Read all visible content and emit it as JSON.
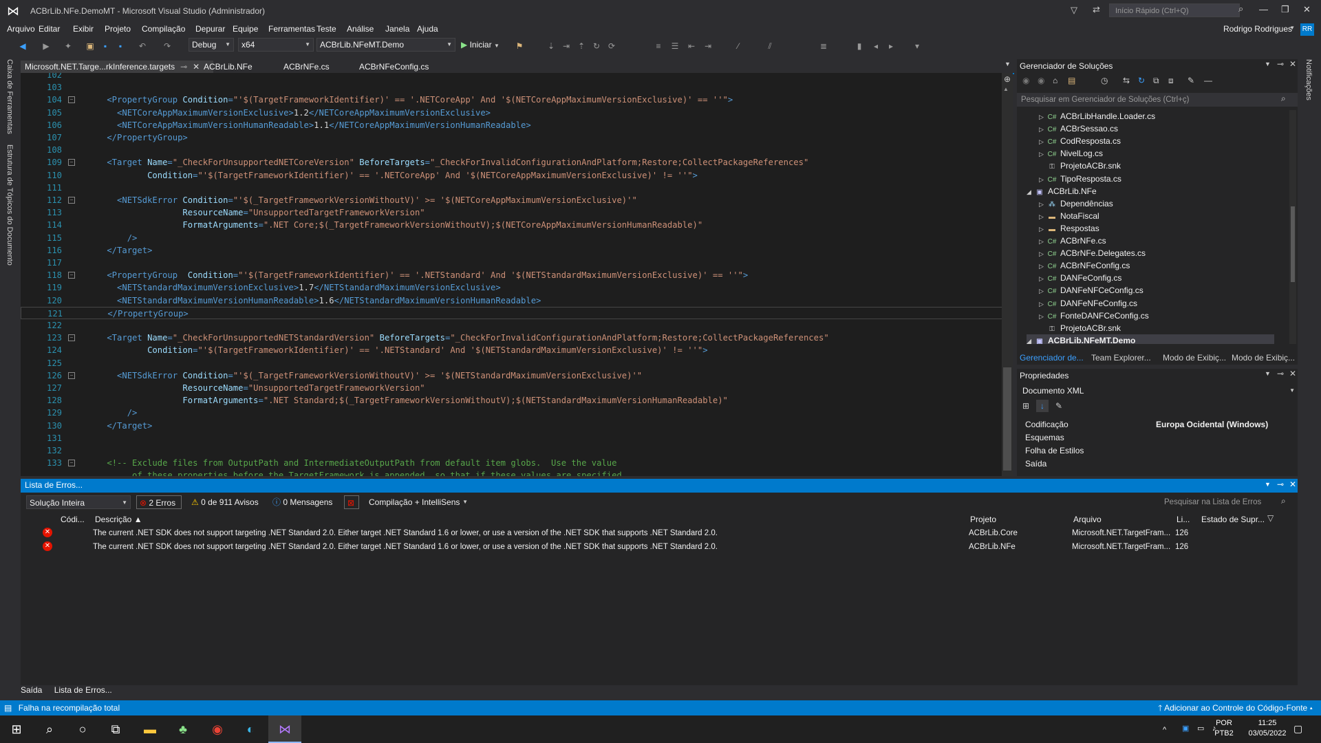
{
  "window": {
    "title": "ACBrLib.NFe.DemoMT - Microsoft Visual Studio (Administrador)",
    "quick_launch_placeholder": "Início Rápido (Ctrl+Q)"
  },
  "menu": [
    "Arquivo",
    "Editar",
    "Exibir",
    "Projeto",
    "Compilação",
    "Depurar",
    "Equipe",
    "Ferramentas",
    "Teste",
    "Análise",
    "Janela",
    "Ajuda"
  ],
  "user": {
    "name": "Rodrigo Rodrigues",
    "initials": "RR"
  },
  "toolbar": {
    "config": "Debug",
    "platform": "x64",
    "startup_project": "ACBrLib.NFeMT.Demo",
    "start_label": "Iniciar"
  },
  "side_tools": {
    "toolbox": "Caixa de Ferramentas",
    "document_outline": "Estrutura de Tópicos do Documento",
    "notifications": "Notificações"
  },
  "editor_tabs": [
    {
      "label": "Microsoft.NET.Targe...rkInference.targets",
      "active": true
    },
    {
      "label": "ACBrLib.NFe"
    },
    {
      "label": "ACBrNFe.cs"
    },
    {
      "label": "ACBrNFeConfig.cs"
    }
  ],
  "code_lines": [
    {
      "n": "102",
      "parts": []
    },
    {
      "n": "103",
      "parts": []
    },
    {
      "n": "104",
      "fold": true,
      "parts": [
        [
          "t",
          "    <PropertyGroup "
        ],
        [
          "a",
          "Condition"
        ],
        [
          "t",
          "="
        ],
        [
          "s",
          "\"'$(TargetFrameworkIdentifier)' == '.NETCoreApp' And '$(NETCoreAppMaximumVersionExclusive)' == ''\""
        ],
        [
          "t",
          ">"
        ]
      ]
    },
    {
      "n": "105",
      "parts": [
        [
          "t",
          "      <NETCoreAppMaximumVersionExclusive>"
        ],
        [
          "x",
          "1.2"
        ],
        [
          "t",
          "</NETCoreAppMaximumVersionExclusive>"
        ]
      ]
    },
    {
      "n": "106",
      "parts": [
        [
          "t",
          "      <NETCoreAppMaximumVersionHumanReadable>"
        ],
        [
          "x",
          "1.1"
        ],
        [
          "t",
          "</NETCoreAppMaximumVersionHumanReadable>"
        ]
      ]
    },
    {
      "n": "107",
      "parts": [
        [
          "t",
          "    </PropertyGroup>"
        ]
      ]
    },
    {
      "n": "108",
      "parts": []
    },
    {
      "n": "109",
      "fold": true,
      "parts": [
        [
          "t",
          "    <Target "
        ],
        [
          "a",
          "Name"
        ],
        [
          "t",
          "="
        ],
        [
          "s",
          "\"_CheckForUnsupportedNETCoreVersion\""
        ],
        [
          "t",
          " "
        ],
        [
          "a",
          "BeforeTargets"
        ],
        [
          "t",
          "="
        ],
        [
          "s",
          "\"_CheckForInvalidConfigurationAndPlatform;Restore;CollectPackageReferences\""
        ]
      ]
    },
    {
      "n": "110",
      "parts": [
        [
          "t",
          "            "
        ],
        [
          "a",
          "Condition"
        ],
        [
          "t",
          "="
        ],
        [
          "s",
          "\"'$(TargetFrameworkIdentifier)' == '.NETCoreApp' And '$(NETCoreAppMaximumVersionExclusive)' != ''\""
        ],
        [
          "t",
          ">"
        ]
      ]
    },
    {
      "n": "111",
      "parts": []
    },
    {
      "n": "112",
      "fold": true,
      "parts": [
        [
          "t",
          "      <NETSdkError "
        ],
        [
          "a",
          "Condition"
        ],
        [
          "t",
          "="
        ],
        [
          "s",
          "\"'$(_TargetFrameworkVersionWithoutV)' >= '$(NETCoreAppMaximumVersionExclusive)'\""
        ]
      ]
    },
    {
      "n": "113",
      "parts": [
        [
          "t",
          "                   "
        ],
        [
          "a",
          "ResourceName"
        ],
        [
          "t",
          "="
        ],
        [
          "s",
          "\"UnsupportedTargetFrameworkVersion\""
        ]
      ]
    },
    {
      "n": "114",
      "parts": [
        [
          "t",
          "                   "
        ],
        [
          "a",
          "FormatArguments"
        ],
        [
          "t",
          "="
        ],
        [
          "s",
          "\".NET Core;$(_TargetFrameworkVersionWithoutV);$(NETCoreAppMaximumVersionHumanReadable)\""
        ]
      ]
    },
    {
      "n": "115",
      "parts": [
        [
          "t",
          "        />"
        ]
      ]
    },
    {
      "n": "116",
      "parts": [
        [
          "t",
          "    </Target>"
        ]
      ]
    },
    {
      "n": "117",
      "parts": []
    },
    {
      "n": "118",
      "fold": true,
      "parts": [
        [
          "t",
          "    <PropertyGroup  "
        ],
        [
          "a",
          "Condition"
        ],
        [
          "t",
          "="
        ],
        [
          "s",
          "\"'$(TargetFrameworkIdentifier)' == '.NETStandard' And '$(NETStandardMaximumVersionExclusive)' == ''\""
        ],
        [
          "t",
          ">"
        ]
      ]
    },
    {
      "n": "119",
      "parts": [
        [
          "t",
          "      <NETStandardMaximumVersionExclusive>"
        ],
        [
          "x",
          "1.7"
        ],
        [
          "t",
          "</NETStandardMaximumVersionExclusive>"
        ]
      ]
    },
    {
      "n": "120",
      "parts": [
        [
          "t",
          "      <NETStandardMaximumVersionHumanReadable>"
        ],
        [
          "x",
          "1.6"
        ],
        [
          "t",
          "</NETStandardMaximumVersionHumanReadable>"
        ]
      ]
    },
    {
      "n": "121",
      "current": true,
      "parts": [
        [
          "t",
          "    </PropertyGroup>"
        ]
      ]
    },
    {
      "n": "122",
      "parts": []
    },
    {
      "n": "123",
      "fold": true,
      "parts": [
        [
          "t",
          "    <Target "
        ],
        [
          "a",
          "Name"
        ],
        [
          "t",
          "="
        ],
        [
          "s",
          "\"_CheckForUnsupportedNETStandardVersion\""
        ],
        [
          "t",
          " "
        ],
        [
          "a",
          "BeforeTargets"
        ],
        [
          "t",
          "="
        ],
        [
          "s",
          "\"_CheckForInvalidConfigurationAndPlatform;Restore;CollectPackageReferences\""
        ]
      ]
    },
    {
      "n": "124",
      "parts": [
        [
          "t",
          "            "
        ],
        [
          "a",
          "Condition"
        ],
        [
          "t",
          "="
        ],
        [
          "s",
          "\"'$(TargetFrameworkIdentifier)' == '.NETStandard' And '$(NETStandardMaximumVersionExclusive)' != ''\""
        ],
        [
          "t",
          ">"
        ]
      ]
    },
    {
      "n": "125",
      "parts": []
    },
    {
      "n": "126",
      "fold": true,
      "parts": [
        [
          "t",
          "      <NETSdkError "
        ],
        [
          "a",
          "Condition"
        ],
        [
          "t",
          "="
        ],
        [
          "s",
          "\"'$(_TargetFrameworkVersionWithoutV)' >= '$(NETStandardMaximumVersionExclusive)'\""
        ]
      ]
    },
    {
      "n": "127",
      "parts": [
        [
          "t",
          "                   "
        ],
        [
          "a",
          "ResourceName"
        ],
        [
          "t",
          "="
        ],
        [
          "s",
          "\"UnsupportedTargetFrameworkVersion\""
        ]
      ]
    },
    {
      "n": "128",
      "parts": [
        [
          "t",
          "                   "
        ],
        [
          "a",
          "FormatArguments"
        ],
        [
          "t",
          "="
        ],
        [
          "s",
          "\".NET Standard;$(_TargetFrameworkVersionWithoutV);$(NETStandardMaximumVersionHumanReadable)\""
        ]
      ]
    },
    {
      "n": "129",
      "parts": [
        [
          "t",
          "        />"
        ]
      ]
    },
    {
      "n": "130",
      "parts": [
        [
          "t",
          "    </Target>"
        ]
      ]
    },
    {
      "n": "131",
      "parts": []
    },
    {
      "n": "132",
      "parts": []
    },
    {
      "n": "133",
      "fold": true,
      "parts": [
        [
          "t",
          "    "
        ],
        [
          "c",
          "<!-- Exclude files from OutputPath and IntermediateOutputPath from default item globs.  Use the value"
        ]
      ]
    },
    {
      "n": "",
      "parts": [
        [
          "c",
          "         of these properties before the TargetFramework is appended, so that if these values are specified"
        ]
      ]
    }
  ],
  "solution_explorer": {
    "title": "Gerenciador de Soluções",
    "search_placeholder": "Pesquisar em Gerenciador de Soluções (Ctrl+ç)",
    "items": [
      {
        "label": "ACBrLibHandle.Loader.cs",
        "indent": 2,
        "icon": "cs",
        "arrow": "▷"
      },
      {
        "label": "ACBrSessao.cs",
        "indent": 2,
        "icon": "cs",
        "arrow": "▷"
      },
      {
        "label": "CodResposta.cs",
        "indent": 2,
        "icon": "cs",
        "arrow": "▷"
      },
      {
        "label": "NivelLog.cs",
        "indent": 2,
        "icon": "cs",
        "arrow": "▷"
      },
      {
        "label": "ProjetoACBr.snk",
        "indent": 2,
        "icon": "snk",
        "arrow": ""
      },
      {
        "label": "TipoResposta.cs",
        "indent": 2,
        "icon": "cs",
        "arrow": "▷"
      },
      {
        "label": "ACBrLib.NFe",
        "indent": 1,
        "icon": "proj",
        "arrow": "◢"
      },
      {
        "label": "Dependências",
        "indent": 2,
        "icon": "dep",
        "arrow": "▷"
      },
      {
        "label": "NotaFiscal",
        "indent": 2,
        "icon": "folder",
        "arrow": "▷"
      },
      {
        "label": "Respostas",
        "indent": 2,
        "icon": "folder",
        "arrow": "▷"
      },
      {
        "label": "ACBrNFe.cs",
        "indent": 2,
        "icon": "cs",
        "arrow": "▷"
      },
      {
        "label": "ACBrNFe.Delegates.cs",
        "indent": 2,
        "icon": "cs",
        "arrow": "▷"
      },
      {
        "label": "ACBrNFeConfig.cs",
        "indent": 2,
        "icon": "cs",
        "arrow": "▷"
      },
      {
        "label": "DANFeConfig.cs",
        "indent": 2,
        "icon": "cs",
        "arrow": "▷"
      },
      {
        "label": "DANFeNFCeConfig.cs",
        "indent": 2,
        "icon": "cs",
        "arrow": "▷"
      },
      {
        "label": "DANFeNFeConfig.cs",
        "indent": 2,
        "icon": "cs",
        "arrow": "▷"
      },
      {
        "label": "FonteDANFCeConfig.cs",
        "indent": 2,
        "icon": "cs",
        "arrow": "▷"
      },
      {
        "label": "ProjetoACBr.snk",
        "indent": 2,
        "icon": "snk",
        "arrow": ""
      },
      {
        "label": "ACBrLib.NFeMT.Demo",
        "indent": 1,
        "icon": "proj",
        "arrow": "◢",
        "bold": true
      }
    ],
    "bottom_tabs": [
      "Gerenciador de...",
      "Team Explorer...",
      "Modo de Exibiç...",
      "Modo de Exibiç..."
    ]
  },
  "properties": {
    "title": "Propriedades",
    "object": "Documento XML",
    "rows": [
      {
        "name": "Codificação",
        "value": "Europa Ocidental (Windows)"
      },
      {
        "name": "Esquemas",
        "value": ""
      },
      {
        "name": "Folha de Estilos",
        "value": ""
      },
      {
        "name": "Saída",
        "value": ""
      }
    ]
  },
  "error_list": {
    "title": "Lista de Erros...",
    "scope": "Solução Inteira",
    "errors_btn": "2 Erros",
    "warnings_btn": "0 de 911 Avisos",
    "messages_btn": "0 Mensagens",
    "build_filter": "Compilação + IntelliSens",
    "search_placeholder": "Pesquisar na Lista de Erros",
    "columns": [
      "Códi...",
      "Descrição",
      "Projeto",
      "Arquivo",
      "Li...",
      "Estado de Supr..."
    ],
    "rows": [
      {
        "description": "The current .NET SDK does not support targeting .NET Standard 2.0.  Either target .NET Standard 1.6 or lower, or use a version of the .NET SDK that supports .NET Standard 2.0.",
        "project": "ACBrLib.Core",
        "file": "Microsoft.NET.TargetFram...",
        "line": "126"
      },
      {
        "description": "The current .NET SDK does not support targeting .NET Standard 2.0.  Either target .NET Standard 1.6 or lower, or use a version of the .NET SDK that supports .NET Standard 2.0.",
        "project": "ACBrLib.NFe",
        "file": "Microsoft.NET.TargetFram...",
        "line": "126"
      }
    ]
  },
  "bottom_tabs": [
    "Saída",
    "Lista de Erros..."
  ],
  "status": {
    "message": "Falha na recompilação total",
    "source_control": "Adicionar ao Controle do Código-Fonte"
  },
  "taskbar": {
    "lang": "POR",
    "layout": "PTB2",
    "time": "11:25",
    "date": "03/05/2022"
  }
}
